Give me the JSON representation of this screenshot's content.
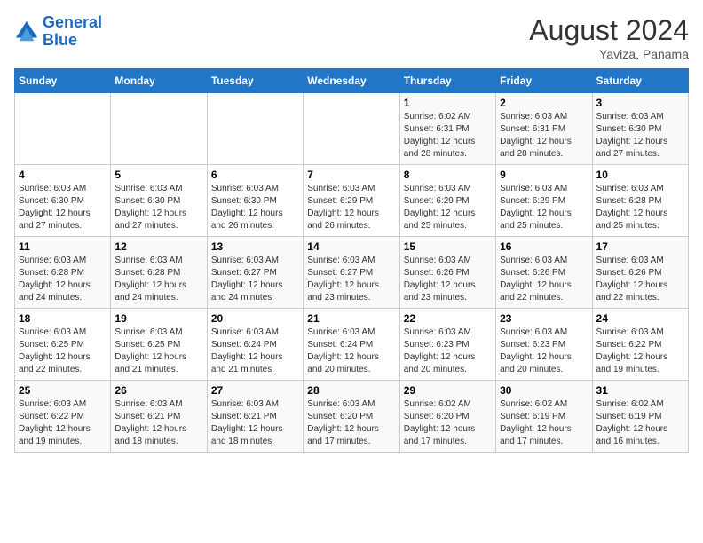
{
  "header": {
    "logo_line1": "General",
    "logo_line2": "Blue",
    "month_year": "August 2024",
    "location": "Yaviza, Panama"
  },
  "weekdays": [
    "Sunday",
    "Monday",
    "Tuesday",
    "Wednesday",
    "Thursday",
    "Friday",
    "Saturday"
  ],
  "weeks": [
    [
      {
        "day": "",
        "info": ""
      },
      {
        "day": "",
        "info": ""
      },
      {
        "day": "",
        "info": ""
      },
      {
        "day": "",
        "info": ""
      },
      {
        "day": "1",
        "info": "Sunrise: 6:02 AM\nSunset: 6:31 PM\nDaylight: 12 hours\nand 28 minutes."
      },
      {
        "day": "2",
        "info": "Sunrise: 6:03 AM\nSunset: 6:31 PM\nDaylight: 12 hours\nand 28 minutes."
      },
      {
        "day": "3",
        "info": "Sunrise: 6:03 AM\nSunset: 6:30 PM\nDaylight: 12 hours\nand 27 minutes."
      }
    ],
    [
      {
        "day": "4",
        "info": "Sunrise: 6:03 AM\nSunset: 6:30 PM\nDaylight: 12 hours\nand 27 minutes."
      },
      {
        "day": "5",
        "info": "Sunrise: 6:03 AM\nSunset: 6:30 PM\nDaylight: 12 hours\nand 27 minutes."
      },
      {
        "day": "6",
        "info": "Sunrise: 6:03 AM\nSunset: 6:30 PM\nDaylight: 12 hours\nand 26 minutes."
      },
      {
        "day": "7",
        "info": "Sunrise: 6:03 AM\nSunset: 6:29 PM\nDaylight: 12 hours\nand 26 minutes."
      },
      {
        "day": "8",
        "info": "Sunrise: 6:03 AM\nSunset: 6:29 PM\nDaylight: 12 hours\nand 25 minutes."
      },
      {
        "day": "9",
        "info": "Sunrise: 6:03 AM\nSunset: 6:29 PM\nDaylight: 12 hours\nand 25 minutes."
      },
      {
        "day": "10",
        "info": "Sunrise: 6:03 AM\nSunset: 6:28 PM\nDaylight: 12 hours\nand 25 minutes."
      }
    ],
    [
      {
        "day": "11",
        "info": "Sunrise: 6:03 AM\nSunset: 6:28 PM\nDaylight: 12 hours\nand 24 minutes."
      },
      {
        "day": "12",
        "info": "Sunrise: 6:03 AM\nSunset: 6:28 PM\nDaylight: 12 hours\nand 24 minutes."
      },
      {
        "day": "13",
        "info": "Sunrise: 6:03 AM\nSunset: 6:27 PM\nDaylight: 12 hours\nand 24 minutes."
      },
      {
        "day": "14",
        "info": "Sunrise: 6:03 AM\nSunset: 6:27 PM\nDaylight: 12 hours\nand 23 minutes."
      },
      {
        "day": "15",
        "info": "Sunrise: 6:03 AM\nSunset: 6:26 PM\nDaylight: 12 hours\nand 23 minutes."
      },
      {
        "day": "16",
        "info": "Sunrise: 6:03 AM\nSunset: 6:26 PM\nDaylight: 12 hours\nand 22 minutes."
      },
      {
        "day": "17",
        "info": "Sunrise: 6:03 AM\nSunset: 6:26 PM\nDaylight: 12 hours\nand 22 minutes."
      }
    ],
    [
      {
        "day": "18",
        "info": "Sunrise: 6:03 AM\nSunset: 6:25 PM\nDaylight: 12 hours\nand 22 minutes."
      },
      {
        "day": "19",
        "info": "Sunrise: 6:03 AM\nSunset: 6:25 PM\nDaylight: 12 hours\nand 21 minutes."
      },
      {
        "day": "20",
        "info": "Sunrise: 6:03 AM\nSunset: 6:24 PM\nDaylight: 12 hours\nand 21 minutes."
      },
      {
        "day": "21",
        "info": "Sunrise: 6:03 AM\nSunset: 6:24 PM\nDaylight: 12 hours\nand 20 minutes."
      },
      {
        "day": "22",
        "info": "Sunrise: 6:03 AM\nSunset: 6:23 PM\nDaylight: 12 hours\nand 20 minutes."
      },
      {
        "day": "23",
        "info": "Sunrise: 6:03 AM\nSunset: 6:23 PM\nDaylight: 12 hours\nand 20 minutes."
      },
      {
        "day": "24",
        "info": "Sunrise: 6:03 AM\nSunset: 6:22 PM\nDaylight: 12 hours\nand 19 minutes."
      }
    ],
    [
      {
        "day": "25",
        "info": "Sunrise: 6:03 AM\nSunset: 6:22 PM\nDaylight: 12 hours\nand 19 minutes."
      },
      {
        "day": "26",
        "info": "Sunrise: 6:03 AM\nSunset: 6:21 PM\nDaylight: 12 hours\nand 18 minutes."
      },
      {
        "day": "27",
        "info": "Sunrise: 6:03 AM\nSunset: 6:21 PM\nDaylight: 12 hours\nand 18 minutes."
      },
      {
        "day": "28",
        "info": "Sunrise: 6:03 AM\nSunset: 6:20 PM\nDaylight: 12 hours\nand 17 minutes."
      },
      {
        "day": "29",
        "info": "Sunrise: 6:02 AM\nSunset: 6:20 PM\nDaylight: 12 hours\nand 17 minutes."
      },
      {
        "day": "30",
        "info": "Sunrise: 6:02 AM\nSunset: 6:19 PM\nDaylight: 12 hours\nand 17 minutes."
      },
      {
        "day": "31",
        "info": "Sunrise: 6:02 AM\nSunset: 6:19 PM\nDaylight: 12 hours\nand 16 minutes."
      }
    ]
  ]
}
